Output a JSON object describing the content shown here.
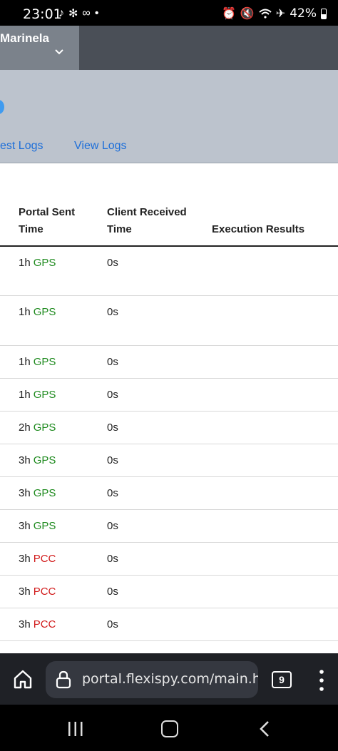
{
  "status_bar": {
    "time": "23:01",
    "left_icons": [
      "tiktok-icon",
      "settings-icon",
      "infinity-icon",
      "dot-icon"
    ],
    "right_icons": [
      "alarm-icon",
      "mute-icon",
      "wifi-icon",
      "airplane-icon"
    ],
    "battery_percent": "42%"
  },
  "header": {
    "user_name": "Marinela"
  },
  "subheader": {
    "links": [
      "est Logs",
      "View Logs"
    ]
  },
  "table": {
    "columns": [
      "Portal Sent Time",
      "Client Received Time",
      "Execution Results"
    ],
    "rows": [
      {
        "sent": "1h",
        "type": "GPS",
        "received": "0s"
      },
      {
        "sent": "1h",
        "type": "GPS",
        "received": "0s"
      },
      {
        "sent": "1h",
        "type": "GPS",
        "received": "0s"
      },
      {
        "sent": "1h",
        "type": "GPS",
        "received": "0s"
      },
      {
        "sent": "2h",
        "type": "GPS",
        "received": "0s"
      },
      {
        "sent": "3h",
        "type": "GPS",
        "received": "0s"
      },
      {
        "sent": "3h",
        "type": "GPS",
        "received": "0s"
      },
      {
        "sent": "3h",
        "type": "GPS",
        "received": "0s"
      },
      {
        "sent": "3h",
        "type": "PCC",
        "received": "0s"
      },
      {
        "sent": "3h",
        "type": "PCC",
        "received": "0s"
      },
      {
        "sent": "3h",
        "type": "PCC",
        "received": "0s"
      }
    ]
  },
  "browser": {
    "url": "portal.flexispy.com/main.htm",
    "tab_count": "9"
  },
  "colors": {
    "gps": "#1e8a1e",
    "pcc": "#d11a1a",
    "link": "#1e6fd9"
  }
}
